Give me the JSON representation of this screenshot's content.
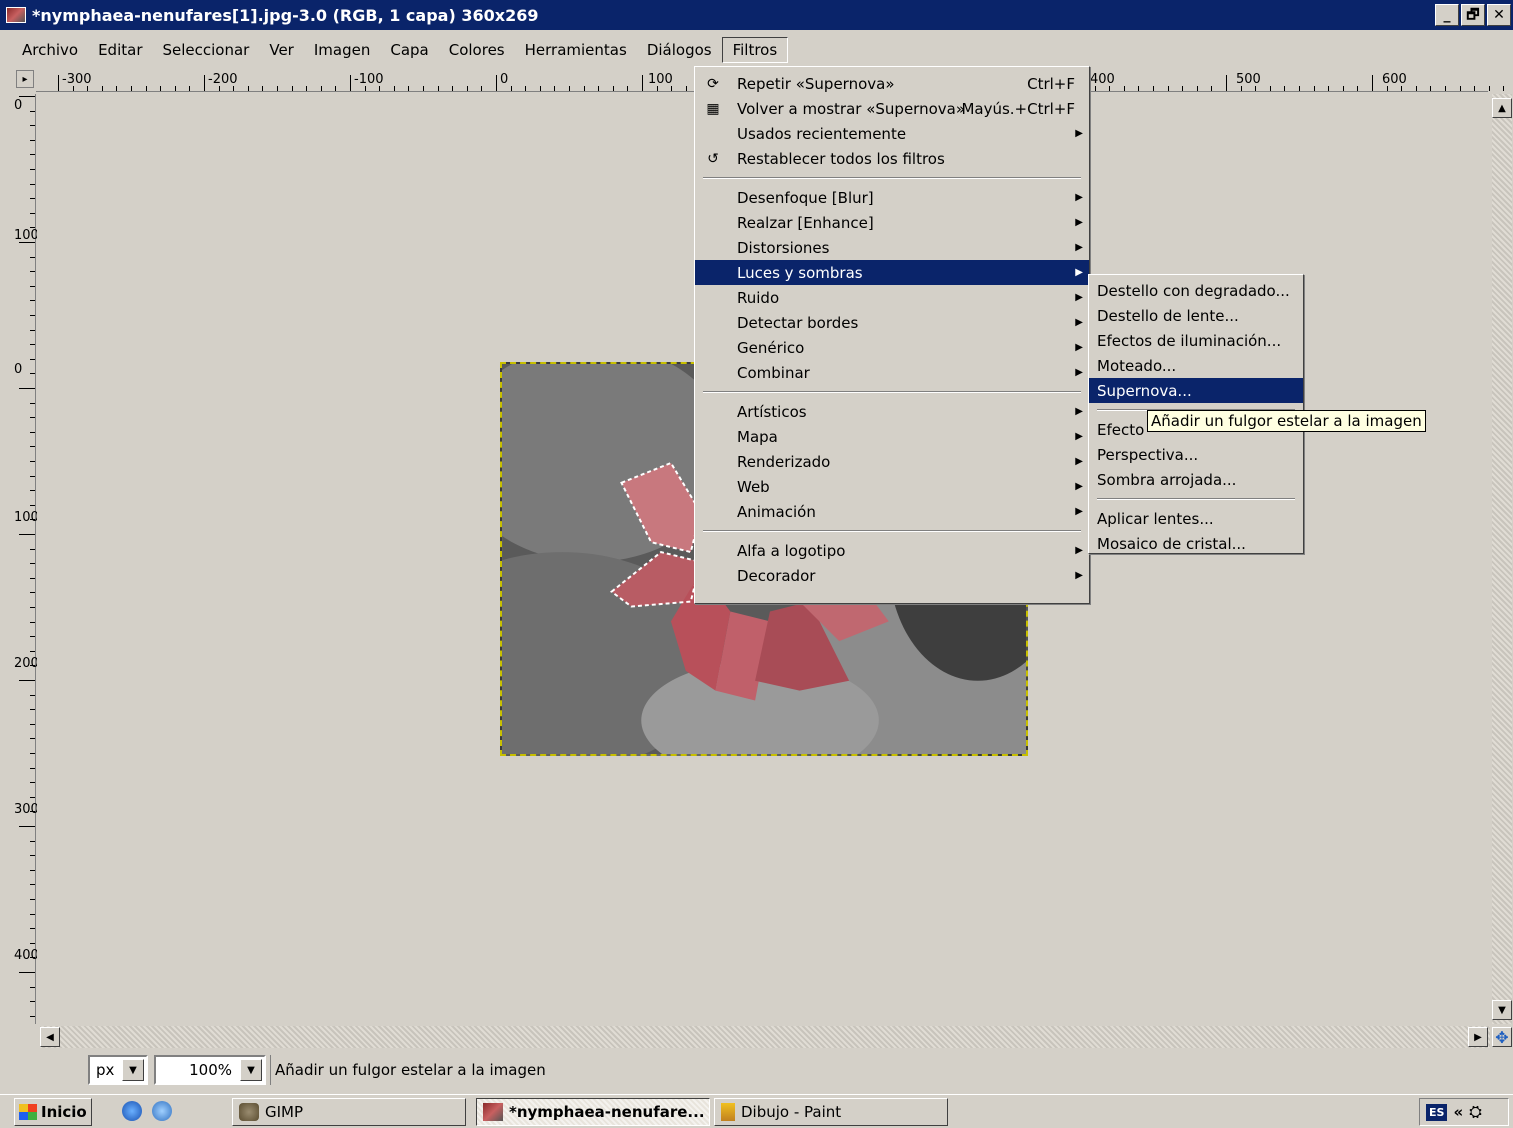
{
  "window": {
    "title": "*nymphaea-nenufares[1].jpg-3.0 (RGB, 1 capa) 360x269",
    "buttons": [
      "_",
      "🗗",
      "✕"
    ]
  },
  "menubar": [
    "Archivo",
    "Editar",
    "Seleccionar",
    "Ver",
    "Imagen",
    "Capa",
    "Colores",
    "Herramientas",
    "Diálogos",
    "Filtros"
  ],
  "ruler": {
    "h_labels": [
      "-300",
      "-200",
      "-100",
      "0",
      "100",
      "400",
      "500",
      "600"
    ],
    "v_labels": [
      "0",
      "100",
      "0",
      "100",
      "200",
      "300",
      "400"
    ]
  },
  "filters_menu": {
    "items": [
      {
        "label": "Repetir «Supernova»",
        "accel": "Ctrl+F",
        "icon": "repeat-icon"
      },
      {
        "label": "Volver a mostrar «Supernova»",
        "accel": "Mayús.+Ctrl+F",
        "icon": "reshow-icon"
      },
      {
        "label": "Usados recientemente",
        "submenu": true
      },
      {
        "label": "Restablecer todos los filtros",
        "icon": "reset-icon"
      },
      {
        "sep": true
      },
      {
        "label": "Desenfoque [Blur]",
        "submenu": true
      },
      {
        "label": "Realzar [Enhance]",
        "submenu": true
      },
      {
        "label": "Distorsiones",
        "submenu": true
      },
      {
        "label": "Luces y sombras",
        "submenu": true,
        "highlight": true
      },
      {
        "label": "Ruido",
        "submenu": true
      },
      {
        "label": "Detectar bordes",
        "submenu": true
      },
      {
        "label": "Genérico",
        "submenu": true
      },
      {
        "label": "Combinar",
        "submenu": true
      },
      {
        "sep": true
      },
      {
        "label": "Artísticos",
        "submenu": true
      },
      {
        "label": "Mapa",
        "submenu": true
      },
      {
        "label": "Renderizado",
        "submenu": true
      },
      {
        "label": "Web",
        "submenu": true
      },
      {
        "label": "Animación",
        "submenu": true
      },
      {
        "sep": true
      },
      {
        "label": "Alfa a logotipo",
        "submenu": true
      },
      {
        "label": "Decorador",
        "submenu": true
      }
    ]
  },
  "lights_submenu": {
    "items": [
      {
        "label": "Destello con degradado..."
      },
      {
        "label": "Destello de lente..."
      },
      {
        "label": "Efectos de iluminación..."
      },
      {
        "label": "Moteado..."
      },
      {
        "label": "Supernova...",
        "highlight": true
      },
      {
        "sep": true
      },
      {
        "label": "Efecto"
      },
      {
        "label": "Perspectiva..."
      },
      {
        "label": "Sombra arrojada..."
      },
      {
        "sep": true
      },
      {
        "label": "Aplicar lentes..."
      },
      {
        "label": "Mosaico de cristal..."
      }
    ]
  },
  "tooltip": "Añadir un fulgor estelar a la imagen",
  "status": {
    "unit": "px",
    "zoom": "100%",
    "message": "Añadir un fulgor estelar a la imagen"
  },
  "taskbar": {
    "start": "Inicio",
    "tasks": [
      "GIMP",
      "*nymphaea-nenufare...",
      "Dibujo - Paint"
    ],
    "lang": "ES",
    "tray_chevron": "«"
  }
}
